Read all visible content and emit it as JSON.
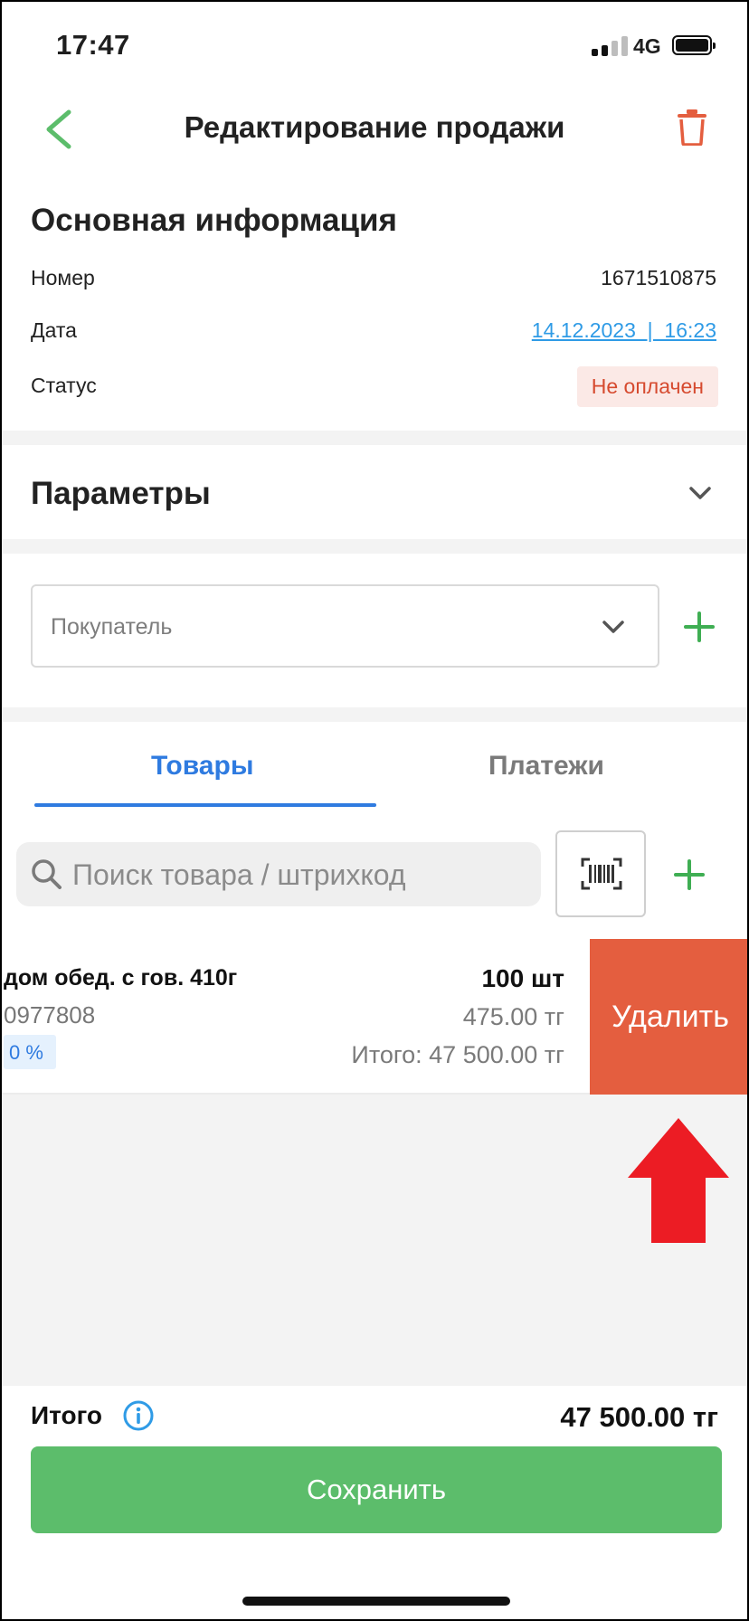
{
  "status_bar": {
    "time": "17:47",
    "network": "4G"
  },
  "header": {
    "title": "Редактирование продажи"
  },
  "basic_info": {
    "heading": "Основная информация",
    "number_label": "Номер",
    "number_value": "1671510875",
    "date_label": "Дата",
    "date_value": "14.12.2023  |  16:23",
    "status_label": "Статус",
    "status_value": "Не оплачен"
  },
  "parameters": {
    "heading": "Параметры"
  },
  "buyer": {
    "placeholder": "Покупатель"
  },
  "tabs": [
    {
      "label": "Товары",
      "active": true
    },
    {
      "label": "Платежи",
      "active": false
    }
  ],
  "search": {
    "placeholder": "Поиск товара / штрихкод"
  },
  "product": {
    "name": "дом обед. с гов. 410г",
    "code": "0977808",
    "discount": "0 %",
    "quantity": "100 шт",
    "price": "475.00 тг",
    "total": "Итого: 47 500.00 тг",
    "delete_label": "Удалить"
  },
  "footer": {
    "total_label": "Итого",
    "total_value": "47 500.00 тг",
    "save_label": "Сохранить"
  },
  "colors": {
    "accent_green": "#5cbd6b",
    "accent_blue": "#2f7be0",
    "delete_red": "#e45e3f",
    "annotation_arrow": "#ec1c24"
  }
}
